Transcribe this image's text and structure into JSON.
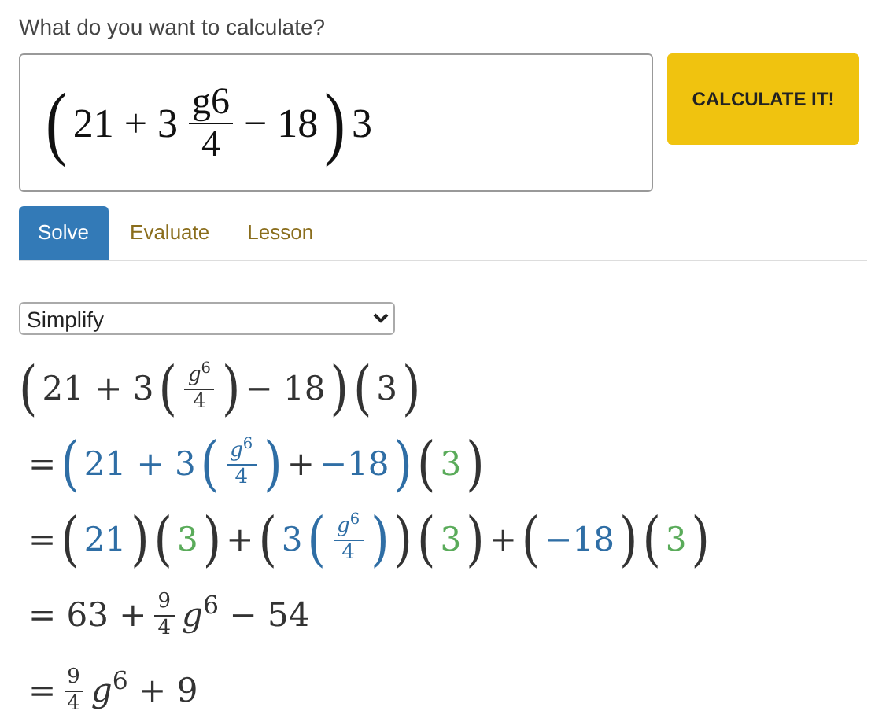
{
  "prompt": "What do you want to calculate?",
  "input": {
    "tokens": [
      {
        "kind": "paren",
        "t": "("
      },
      {
        "kind": "text",
        "t": "21 + 3"
      },
      {
        "kind": "frac",
        "num": "g6",
        "den": "4"
      },
      {
        "kind": "text",
        "t": "− 18"
      },
      {
        "kind": "paren",
        "t": ")"
      },
      {
        "kind": "text",
        "t": "3"
      }
    ]
  },
  "button": "CALCULATE IT!",
  "tabs": [
    {
      "label": "Solve",
      "selected": true
    },
    {
      "label": "Evaluate",
      "selected": false
    },
    {
      "label": "Lesson",
      "selected": false
    }
  ],
  "mode_select": {
    "value": "Simplify"
  },
  "steps": [
    {
      "tokens": [
        {
          "kind": "paren",
          "t": "("
        },
        {
          "kind": "text",
          "t": "21 + 3"
        },
        {
          "kind": "paren",
          "t": "("
        },
        {
          "kind": "frac",
          "num": "*g*$^{6}$",
          "den": "4"
        },
        {
          "kind": "paren",
          "t": ")"
        },
        {
          "kind": "text",
          "t": "− 18"
        },
        {
          "kind": "paren",
          "t": ")"
        },
        {
          "kind": "paren",
          "t": "("
        },
        {
          "kind": "text",
          "t": "3"
        },
        {
          "kind": "paren",
          "t": ")"
        }
      ]
    },
    {
      "tokens": [
        {
          "kind": "text",
          "t": "="
        },
        {
          "kind": "paren",
          "t": "(",
          "color": "#2f6ea5"
        },
        {
          "kind": "text",
          "t": "21 + 3",
          "color": "#2f6ea5"
        },
        {
          "kind": "paren",
          "t": "(",
          "color": "#2f6ea5"
        },
        {
          "kind": "frac",
          "num": "*g*$^{6}$",
          "den": "4",
          "color": "#2f6ea5"
        },
        {
          "kind": "paren",
          "t": ")",
          "color": "#2f6ea5"
        },
        {
          "kind": "text",
          "t": "+"
        },
        {
          "kind": "text",
          "t": "−18",
          "color": "#2f6ea5"
        },
        {
          "kind": "paren",
          "t": ")",
          "color": "#2f6ea5"
        },
        {
          "kind": "paren",
          "t": "("
        },
        {
          "kind": "text",
          "t": "3",
          "color": "#5aab5a"
        },
        {
          "kind": "paren",
          "t": ")"
        }
      ]
    },
    {
      "tokens": [
        {
          "kind": "text",
          "t": "="
        },
        {
          "kind": "paren",
          "t": "("
        },
        {
          "kind": "text",
          "t": "21",
          "color": "#2f6ea5"
        },
        {
          "kind": "paren",
          "t": ")"
        },
        {
          "kind": "paren",
          "t": "("
        },
        {
          "kind": "text",
          "t": "3",
          "color": "#5aab5a"
        },
        {
          "kind": "paren",
          "t": ")"
        },
        {
          "kind": "text",
          "t": "+"
        },
        {
          "kind": "paren",
          "t": "("
        },
        {
          "kind": "text",
          "t": "3",
          "color": "#2f6ea5"
        },
        {
          "kind": "paren",
          "t": "(",
          "color": "#2f6ea5"
        },
        {
          "kind": "frac",
          "num": "*g*$^{6}$",
          "den": "4",
          "color": "#2f6ea5"
        },
        {
          "kind": "paren",
          "t": ")",
          "color": "#2f6ea5"
        },
        {
          "kind": "paren",
          "t": ")"
        },
        {
          "kind": "paren",
          "t": "("
        },
        {
          "kind": "text",
          "t": "3",
          "color": "#5aab5a"
        },
        {
          "kind": "paren",
          "t": ")"
        },
        {
          "kind": "text",
          "t": "+"
        },
        {
          "kind": "paren",
          "t": "("
        },
        {
          "kind": "text",
          "t": "−18",
          "color": "#2f6ea5"
        },
        {
          "kind": "paren",
          "t": ")"
        },
        {
          "kind": "paren",
          "t": "("
        },
        {
          "kind": "text",
          "t": "3",
          "color": "#5aab5a"
        },
        {
          "kind": "paren",
          "t": ")"
        }
      ]
    },
    {
      "tokens": [
        {
          "kind": "text",
          "t": "= 63 +"
        },
        {
          "kind": "frac",
          "num": "9",
          "den": "4"
        },
        {
          "kind": "text",
          "t": "*g*$^{6}$ − 54"
        }
      ]
    },
    {
      "tokens": [
        {
          "kind": "text",
          "t": "="
        },
        {
          "kind": "frac",
          "num": "9",
          "den": "4"
        },
        {
          "kind": "text",
          "t": "*g*$^{6}$ + 9"
        }
      ]
    }
  ]
}
